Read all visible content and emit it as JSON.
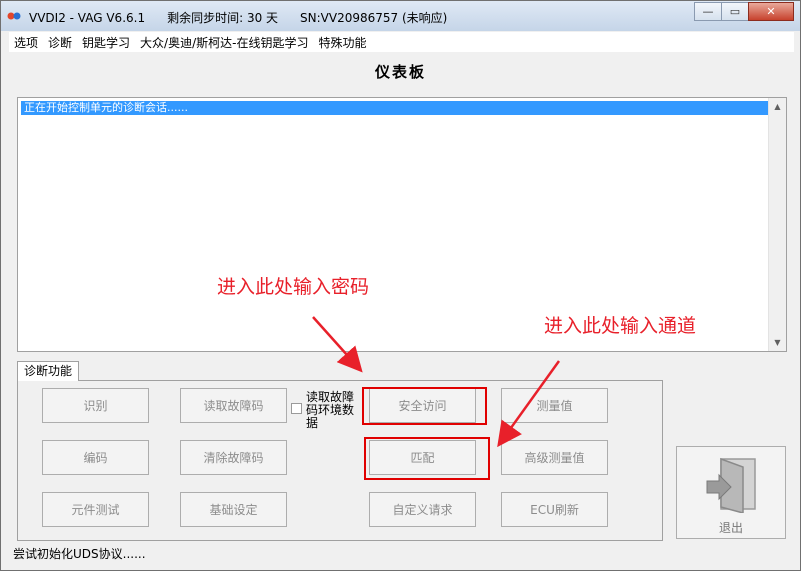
{
  "window": {
    "title_app": "VVDI2 - VAG V6.6.1",
    "title_sync": "剩余同步时间: 30 天",
    "title_sn": "SN:VV20986757 (未响应)",
    "minimize_glyph": "—",
    "maximize_glyph": "▭",
    "close_glyph": "✕"
  },
  "menu": [
    "选项",
    "诊断",
    "钥匙学习",
    "大众/奥迪/斯柯达-在线钥匙学习",
    "特殊功能"
  ],
  "page_title": "仪表板",
  "log": {
    "lines": [
      "正在开始控制单元的诊断会话......"
    ]
  },
  "diag_tab": "诊断功能",
  "buttons": {
    "identify": "识别",
    "read_dtc": "读取故障码",
    "read_freeze_frame": "读取故障码环境数据",
    "security_access": "安全访问",
    "measure": "测量值",
    "coding": "编码",
    "clear_dtc": "清除故障码",
    "adaptation": "匹配",
    "advanced_measure": "高级测量值",
    "component_test": "元件测试",
    "basic_settings": "基础设定",
    "custom_request": "自定义请求",
    "ecu_flash": "ECU刷新",
    "exit": "退出"
  },
  "status_text": "尝试初始化UDS协议......",
  "annotations": {
    "password": "进入此处输入密码",
    "channel": "进入此处输入通道"
  },
  "colors": {
    "highlight": "#e00000",
    "annotation": "#e8202a",
    "selection": "#3399ff"
  },
  "icons": [
    "app-icon",
    "exit-door-icon",
    "checkbox",
    "scroll-up-arrow",
    "scroll-down-arrow"
  ]
}
